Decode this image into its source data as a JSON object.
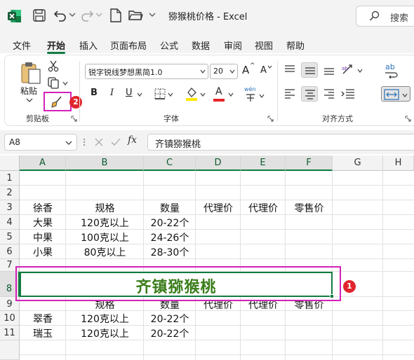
{
  "window": {
    "title": "猕猴桃价格  -  Excel",
    "search_label": "搜索"
  },
  "tabs": [
    {
      "label": "文件"
    },
    {
      "label": "开始"
    },
    {
      "label": "插入"
    },
    {
      "label": "页面布局"
    },
    {
      "label": "公式"
    },
    {
      "label": "数据"
    },
    {
      "label": "审阅"
    },
    {
      "label": "视图"
    },
    {
      "label": "帮助"
    }
  ],
  "ribbon": {
    "paste_label": "粘贴",
    "clipboard_label": "剪贴板",
    "font_label": "字体",
    "align_label": "对齐方式",
    "font_name": "锐字锐线梦想黑简1.0",
    "font_size": "20",
    "bold": "B",
    "italic": "I",
    "underline": "U",
    "font_color_letter": "A",
    "phonetic": "wén",
    "grow": "A",
    "shrink": "A",
    "wrap_glyph": "ab"
  },
  "annotations": {
    "badge1": "1",
    "badge2": "2",
    "highlight_color": "#d321b9",
    "badge_color": "#e0252c"
  },
  "formula_bar": {
    "name_box": "A8",
    "fx": "fx",
    "content": "齐镇猕猴桃"
  },
  "grid": {
    "columns": [
      "A",
      "B",
      "C",
      "D",
      "E",
      "F",
      "G",
      "H"
    ],
    "rows": [
      "1",
      "2",
      "3",
      "4",
      "5",
      "6",
      "7",
      "8",
      "9",
      "10",
      "11"
    ],
    "cells": {
      "r3": [
        "徐香",
        "规格",
        "数量",
        "代理价",
        "代理价",
        "零售价"
      ],
      "r4": [
        "大果",
        "120克以上",
        "20-22个"
      ],
      "r5": [
        "中果",
        "100克以上",
        "24-26个"
      ],
      "r6": [
        "小果",
        "80克以上",
        "28-30个"
      ],
      "r9": [
        "",
        "规格",
        "数量",
        "代理价",
        "代理价",
        "零售价"
      ],
      "r10": [
        "翠香",
        "120克以上",
        "20-22个"
      ],
      "r11": [
        "瑞玉",
        "120克以上",
        "20-22个"
      ]
    },
    "merged_title": "齐镇猕猴桃",
    "merged_color": "#3a7d1a",
    "accent_color": "#107c41"
  }
}
